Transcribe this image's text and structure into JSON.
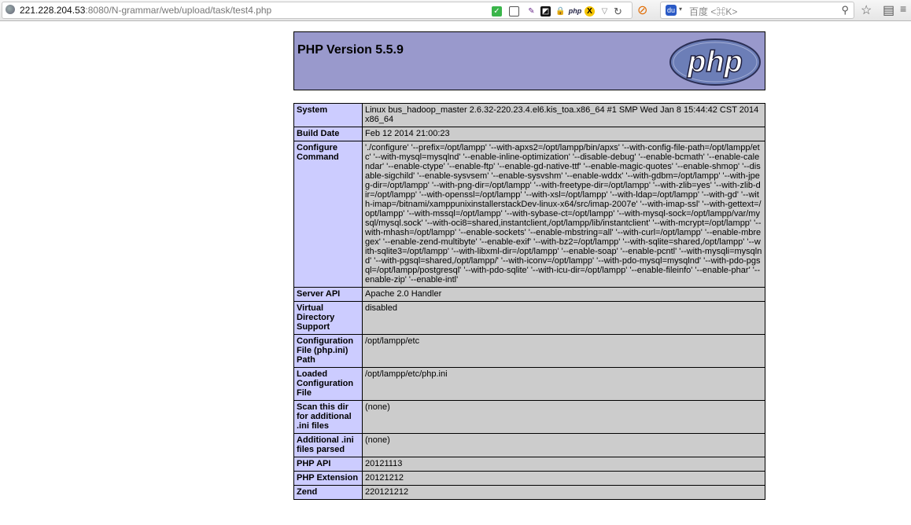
{
  "browser": {
    "url_host": "221.228.204.53",
    "url_rest": ":8080/N-grammar/web/upload/task/test4.php",
    "search_placeholder": "百度 <⌘K>",
    "search_engine_label": "du",
    "php_ext_label": "php"
  },
  "phpinfo": {
    "title": "PHP Version 5.5.9",
    "logo_text": "php",
    "rows": [
      {
        "label": "System",
        "value": "Linux bus_hadoop_master 2.6.32-220.23.4.el6.kis_toa.x86_64 #1 SMP Wed Jan 8 15:44:42 CST 2014 x86_64"
      },
      {
        "label": "Build Date",
        "value": "Feb 12 2014 21:00:23"
      },
      {
        "label": "Configure Command",
        "value": "'./configure' '--prefix=/opt/lampp' '--with-apxs2=/opt/lampp/bin/apxs' '--with-config-file-path=/opt/lampp/etc' '--with-mysql=mysqlnd' '--enable-inline-optimization' '--disable-debug' '--enable-bcmath' '--enable-calendar' '--enable-ctype' '--enable-ftp' '--enable-gd-native-ttf' '--enable-magic-quotes' '--enable-shmop' '--disable-sigchild' '--enable-sysvsem' '--enable-sysvshm' '--enable-wddx' '--with-gdbm=/opt/lampp' '--with-jpeg-dir=/opt/lampp' '--with-png-dir=/opt/lampp' '--with-freetype-dir=/opt/lampp' '--with-zlib=yes' '--with-zlib-dir=/opt/lampp' '--with-openssl=/opt/lampp' '--with-xsl=/opt/lampp' '--with-ldap=/opt/lampp' '--with-gd' '--with-imap=/bitnami/xamppunixinstallerstackDev-linux-x64/src/imap-2007e' '--with-imap-ssl' '--with-gettext=/opt/lampp' '--with-mssql=/opt/lampp' '--with-sybase-ct=/opt/lampp' '--with-mysql-sock=/opt/lampp/var/mysql/mysql.sock' '--with-oci8=shared,instantclient,/opt/lampp/lib/instantclient' '--with-mcrypt=/opt/lampp' '--with-mhash=/opt/lampp' '--enable-sockets' '--enable-mbstring=all' '--with-curl=/opt/lampp' '--enable-mbregex' '--enable-zend-multibyte' '--enable-exif' '--with-bz2=/opt/lampp' '--with-sqlite=shared,/opt/lampp' '--with-sqlite3=/opt/lampp' '--with-libxml-dir=/opt/lampp' '--enable-soap' '--enable-pcntl' '--with-mysqli=mysqlnd' '--with-pgsql=shared,/opt/lampp/' '--with-iconv=/opt/lampp' '--with-pdo-mysql=mysqlnd' '--with-pdo-pgsql=/opt/lampp/postgresql' '--with-pdo-sqlite' '--with-icu-dir=/opt/lampp' '--enable-fileinfo' '--enable-phar' '--enable-zip' '--enable-intl'"
      },
      {
        "label": "Server API",
        "value": "Apache 2.0 Handler"
      },
      {
        "label": "Virtual Directory Support",
        "value": "disabled"
      },
      {
        "label": "Configuration File (php.ini) Path",
        "value": "/opt/lampp/etc"
      },
      {
        "label": "Loaded Configuration File",
        "value": "/opt/lampp/etc/php.ini"
      },
      {
        "label": "Scan this dir for additional .ini files",
        "value": "(none)"
      },
      {
        "label": "Additional .ini files parsed",
        "value": "(none)"
      },
      {
        "label": "PHP API",
        "value": "20121113"
      },
      {
        "label": "PHP Extension",
        "value": "20121212"
      },
      {
        "label": "Zend",
        "value": "220121212"
      }
    ]
  }
}
